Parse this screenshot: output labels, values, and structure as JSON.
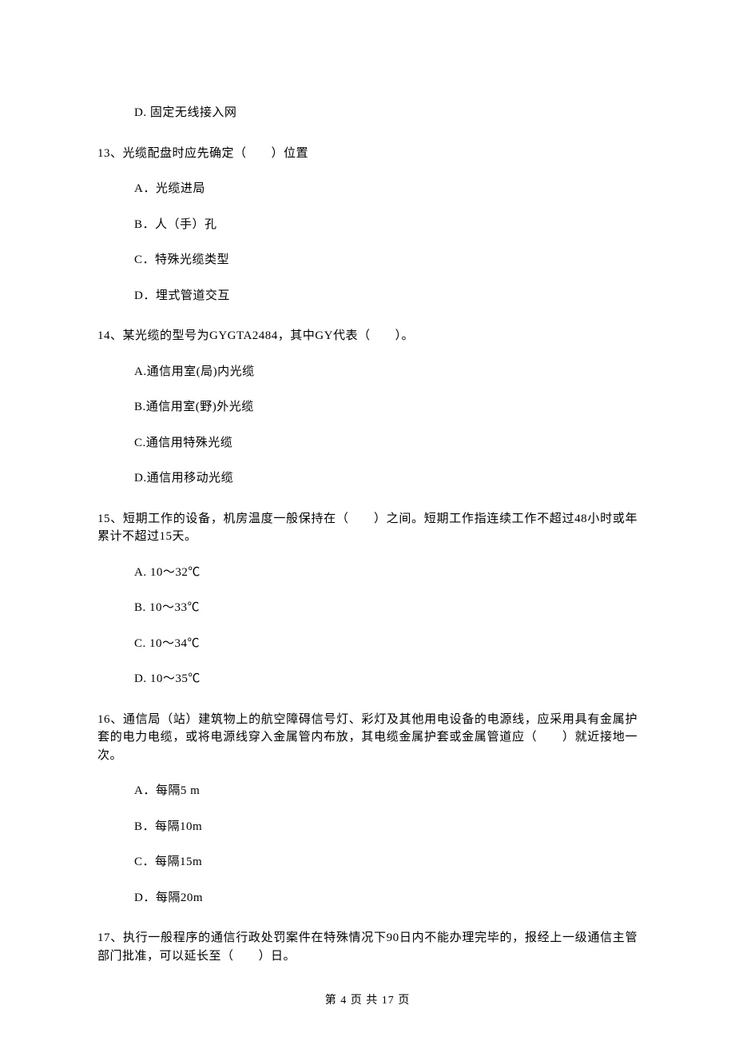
{
  "q12": {
    "optD": "D. 固定无线接入网"
  },
  "q13": {
    "stem": "13、光缆配盘时应先确定（　　）位置",
    "optA": "A．光缆进局",
    "optB": "B．人（手）孔",
    "optC": "C．特殊光缆类型",
    "optD": "D．埋式管道交互"
  },
  "q14": {
    "stem": "14、某光缆的型号为GYGTA2484，其中GY代表（　　）。",
    "optA": "A.通信用室(局)内光缆",
    "optB": "B.通信用室(野)外光缆",
    "optC": "C.通信用特殊光缆",
    "optD": "D.通信用移动光缆"
  },
  "q15": {
    "stem": "15、短期工作的设备，机房温度一般保持在（　　）之间。短期工作指连续工作不超过48小时或年累计不超过15天。",
    "optA": "A. 10～32℃",
    "optB": "B. 10～33℃",
    "optC": "C. 10～34℃",
    "optD": "D. 10～35℃"
  },
  "q16": {
    "stem": "16、通信局（站）建筑物上的航空障碍信号灯、彩灯及其他用电设备的电源线，应采用具有金属护套的电力电缆，或将电源线穿入金属管内布放，其电缆金属护套或金属管道应（　　）就近接地一次。",
    "optA": "A．每隔5 m",
    "optB": "B．每隔10m",
    "optC": "C．每隔15m",
    "optD": "D．每隔20m"
  },
  "q17": {
    "stem": "17、执行一般程序的通信行政处罚案件在特殊情况下90日内不能办理完毕的，报经上一级通信主管部门批准，可以延长至（　　）日。"
  },
  "footer": "第 4 页 共 17 页"
}
